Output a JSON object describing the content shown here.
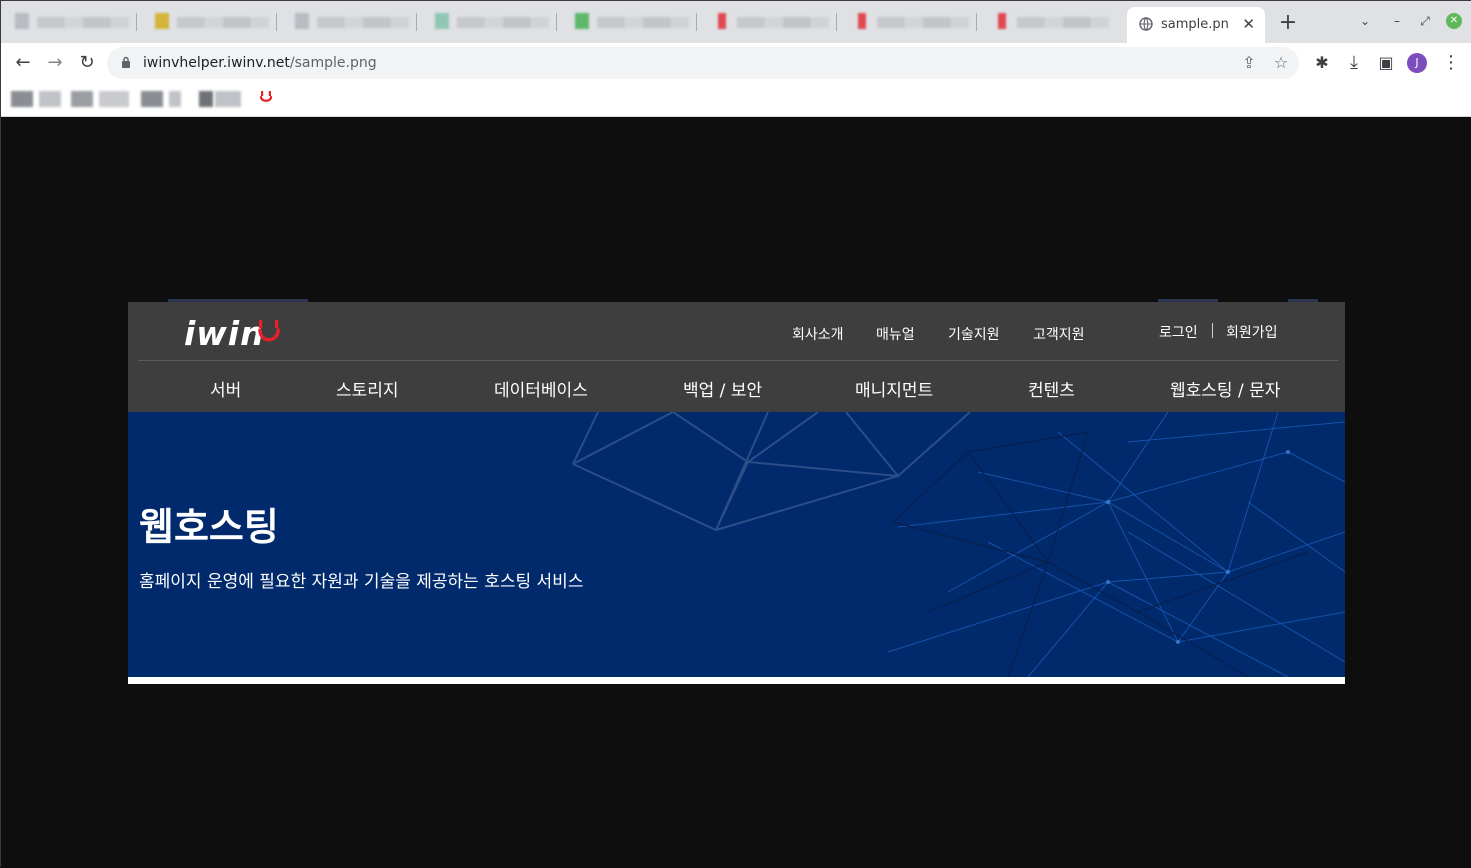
{
  "browser": {
    "active_tab": {
      "title": "sample.png",
      "close_glyph": "✕"
    },
    "new_tab_glyph": "+",
    "window_controls": {
      "dropdown_glyph": "⌄",
      "minimize_glyph": "–",
      "restore_glyph": "⤢",
      "close_glyph": "✕"
    },
    "toolbar": {
      "back_glyph": "←",
      "forward_glyph": "→",
      "reload_glyph": "↻",
      "share_glyph": "⇪",
      "star_glyph": "☆",
      "extensions_glyph": "✱",
      "download_glyph": "⤓",
      "sidepanel_glyph": "▣",
      "menu_glyph": "⋮"
    },
    "address": {
      "host": "iwinvhelper.iwinv.net",
      "path": "/sample.png"
    },
    "profile_initial": "J"
  },
  "site": {
    "logo_text": "iwin",
    "top_nav": [
      "회사소개",
      "매뉴얼",
      "기술지원",
      "고객지원"
    ],
    "account": {
      "login": "로그인",
      "signup": "회원가입"
    },
    "main_nav": [
      "서버",
      "스토리지",
      "데이터베이스",
      "백업 / 보안",
      "매니지먼트",
      "컨텐츠",
      "웹호스팅 / 문자"
    ],
    "hero": {
      "title": "웹호스팅",
      "subtitle": "홈페이지 운영에 필요한 자원과 기술을 제공하는 호스팅 서비스"
    }
  },
  "colors": {
    "header_bg": "#3e3e3e",
    "hero_bg": "#002a6c",
    "logo_accent": "#e8202a",
    "profile_avatar": "#7c4dbd"
  }
}
